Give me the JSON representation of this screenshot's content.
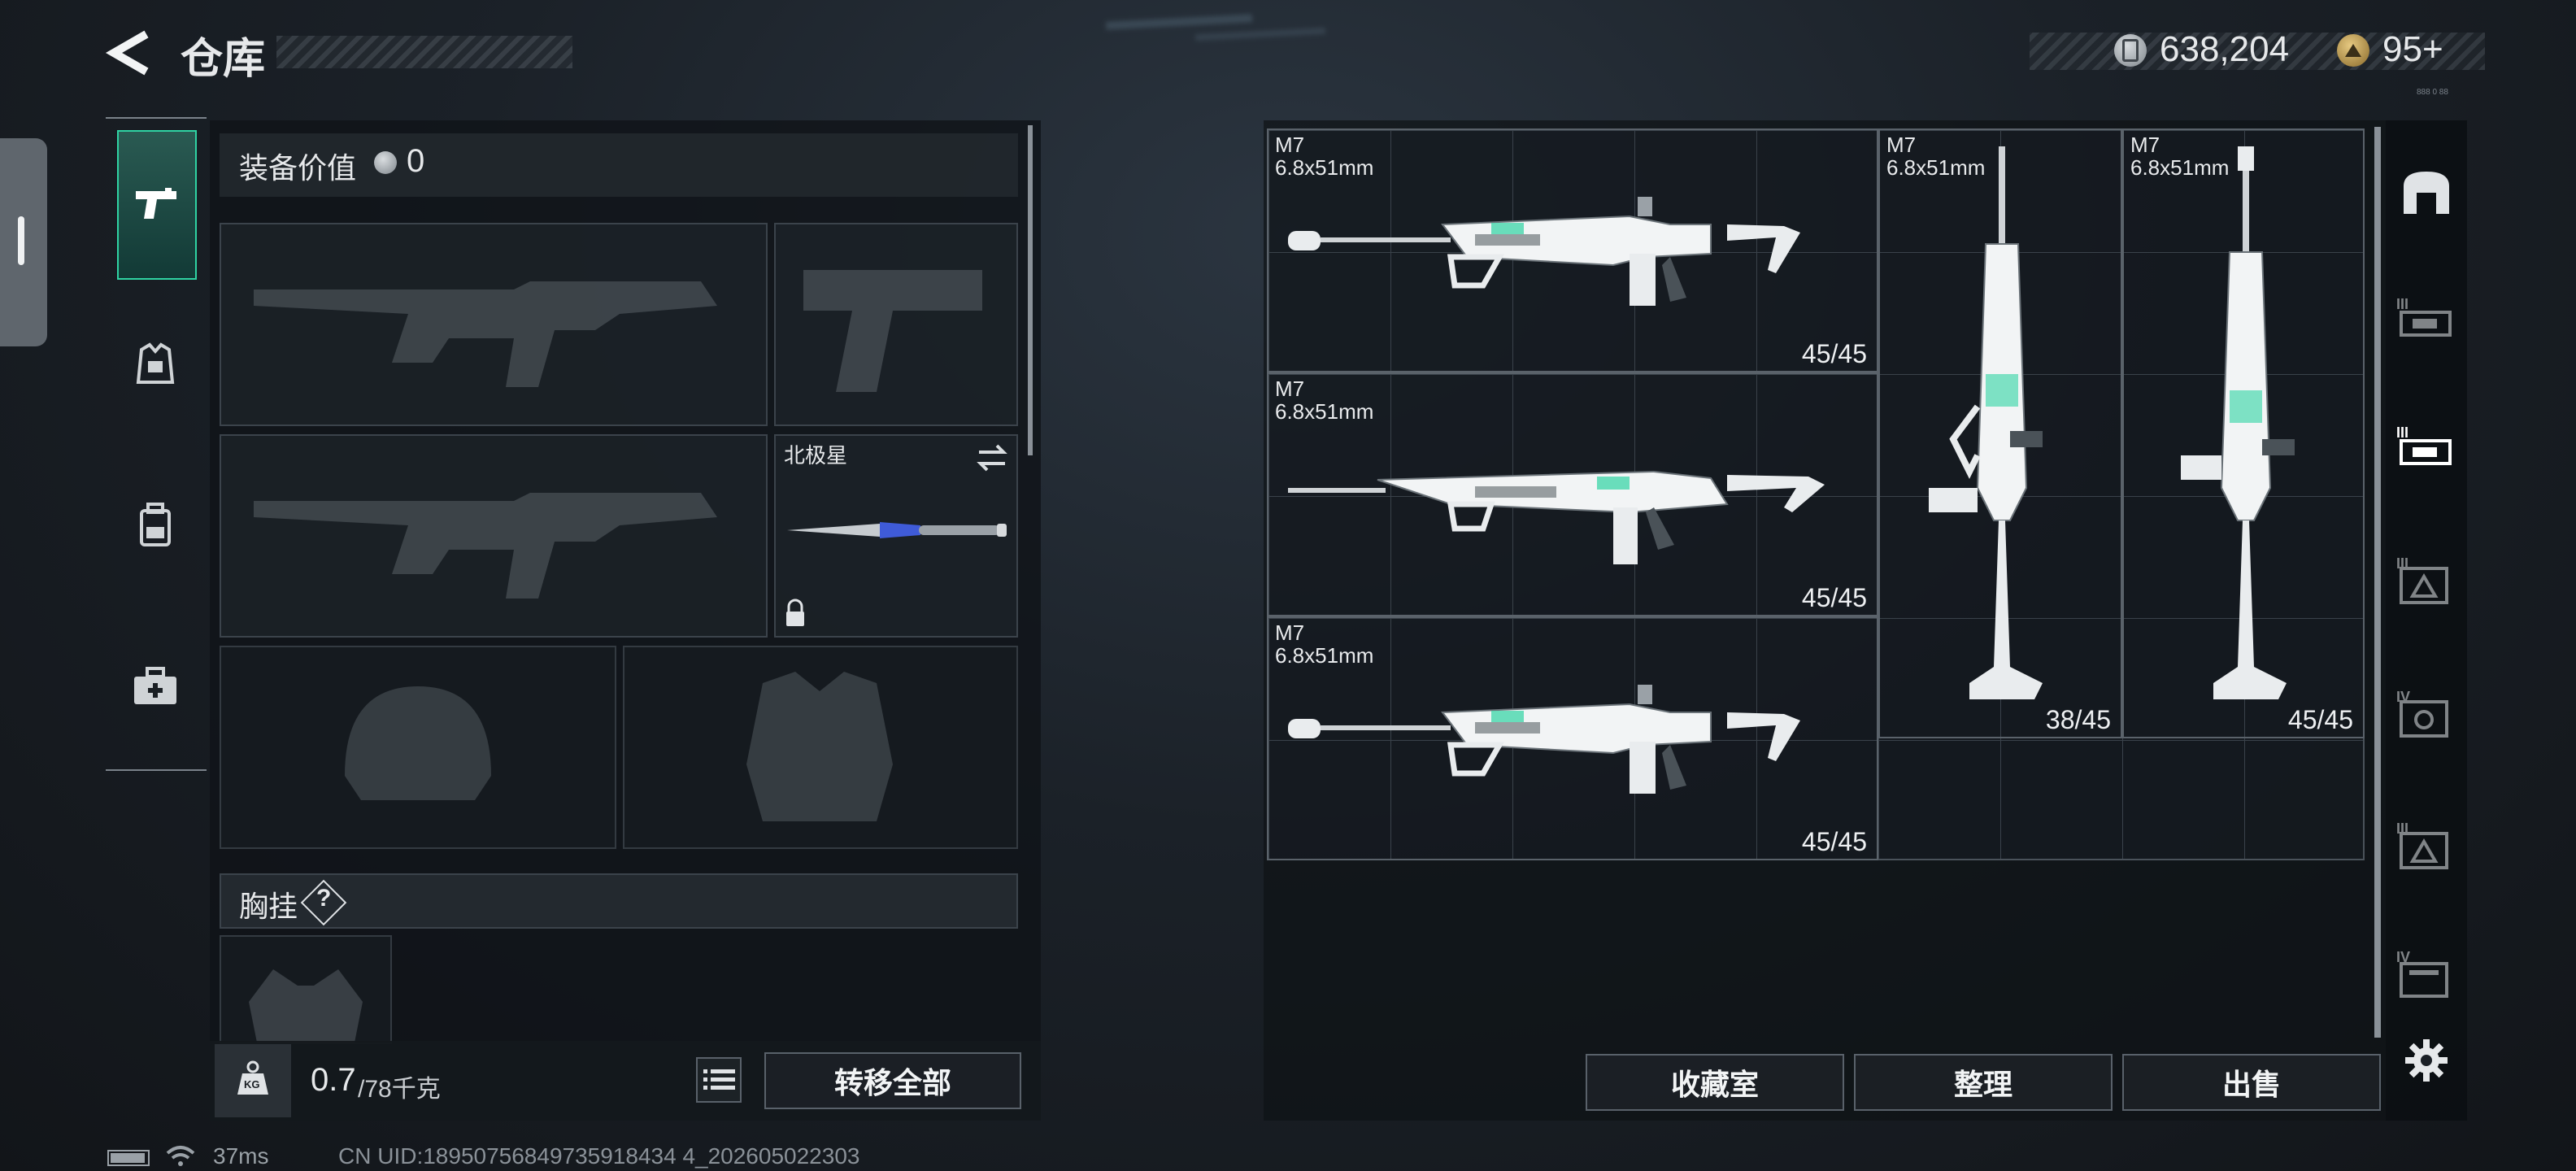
{
  "header": {
    "title": "仓库",
    "currency_amount": "638,204",
    "tickets_amount": "95+",
    "version_small": "888 0 88"
  },
  "left_panel": {
    "equipment_value_label": "装备价值",
    "equipment_value": "0",
    "melee_name": "北极星",
    "chest_rig_label": "胸挂",
    "help_mark": "?",
    "weight_current": "0.7",
    "weight_max": "/78千克",
    "weight_icon_text": "KG",
    "transfer_all_label": "转移全部"
  },
  "storage": {
    "weapons": [
      {
        "name": "M7",
        "caliber": "6.8x51mm",
        "ammo": "45/45"
      },
      {
        "name": "M7",
        "caliber": "6.8x51mm",
        "ammo": "45/45"
      },
      {
        "name": "M7",
        "caliber": "6.8x51mm",
        "ammo": "45/45"
      },
      {
        "name": "M7",
        "caliber": "6.8x51mm",
        "ammo": "38/45"
      },
      {
        "name": "M7",
        "caliber": "6.8x51mm",
        "ammo": "45/45"
      }
    ],
    "buttons": {
      "collection": "收藏室",
      "sort": "整理",
      "sell": "出售"
    },
    "rail_tiers": [
      "III",
      "III",
      "III",
      "IV",
      "III",
      "IV"
    ]
  },
  "status_bar": {
    "ping": "37ms",
    "uid": "CN UID:18950756849735918434 4_202605022303"
  },
  "colors": {
    "accent_green": "#2fd3a3",
    "panel_border": "#3b434b",
    "knife_glow": "#3f5bd8"
  }
}
